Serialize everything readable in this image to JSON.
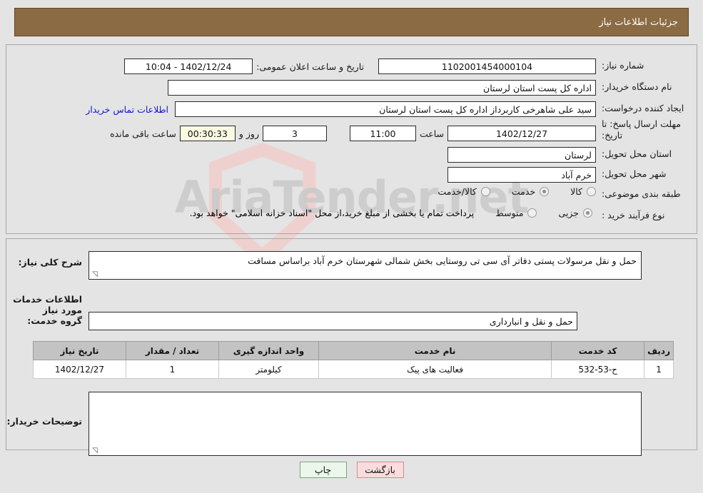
{
  "header": {
    "title": "جزئیات اطلاعات نیاز"
  },
  "form": {
    "need_number_label": "شماره نیاز:",
    "need_number_value": "1102001454000104",
    "buyer_org_label": "نام دستگاه خریدار:",
    "buyer_org_value": "اداره کل پست استان لرستان",
    "creator_label": "ایجاد کننده درخواست:",
    "creator_value": "سید علی شاهرخی کاربرداز اداره کل پست استان لرستان",
    "contact_link": "اطلاعات تماس خریدار",
    "deadline_label": "مهلت ارسال پاسخ: تا تاریخ:",
    "deadline_date": "1402/12/27",
    "hour_label": "ساعت",
    "deadline_time": "11:00",
    "days_remaining": "3",
    "days_label": "روز و",
    "countdown": "00:30:33",
    "remaining_label": "ساعت باقی مانده",
    "announce_label": "تاریخ و ساعت اعلان عمومی:",
    "announce_value": "1402/12/24 - 10:04",
    "province_label": "استان محل تحویل:",
    "province_value": "لرستان",
    "city_label": "شهر محل تحویل:",
    "city_value": "خرم آباد",
    "category_label": "طبقه بندی موضوعی:",
    "category_options": [
      {
        "label": "کالا",
        "selected": false
      },
      {
        "label": "خدمت",
        "selected": true
      },
      {
        "label": "کالا/خدمت",
        "selected": false
      }
    ],
    "process_label": "نوع فرآیند خرید :",
    "process_options": [
      {
        "label": "جزیی",
        "selected": true
      },
      {
        "label": "متوسط",
        "selected": false
      }
    ],
    "process_note": "پرداخت تمام یا بخشی از مبلغ خرید،از محل \"اسناد خزانه اسلامی\" خواهد بود."
  },
  "detail": {
    "general_desc_label": "شرح کلی نیاز:",
    "general_desc_value": "حمل و نقل مرسولات پستی دفاتر آی سی تی روستایی بخش شمالی شهرستان خرم آباد براساس مسافت",
    "services_head": "اطلاعات خدمات مورد نیاز",
    "service_group_label": "گروه خدمت:",
    "service_group_value": "حمل و نقل و انبارداری",
    "buyer_notes_label": "توضیحات خریدار:",
    "buyer_notes_value": ""
  },
  "table": {
    "columns": [
      "ردیف",
      "کد خدمت",
      "نام خدمت",
      "واحد اندازه گیری",
      "تعداد / مقدار",
      "تاریخ نیاز"
    ],
    "rows": [
      {
        "index": "1",
        "code": "ح-53-532",
        "name": "فعالیت های پیک",
        "unit": "کیلومتر",
        "qty": "1",
        "date": "1402/12/27"
      }
    ]
  },
  "buttons": {
    "print": "چاپ",
    "back": "بازگشت"
  },
  "watermark": {
    "text": "AriaTender.net"
  },
  "colors": {
    "header_bg": "#8b6b43",
    "link": "#1414d2",
    "countdown_bg": "#fbfbe4",
    "print_bg": "#eaf7ea",
    "back_bg": "#fbdcdc"
  }
}
